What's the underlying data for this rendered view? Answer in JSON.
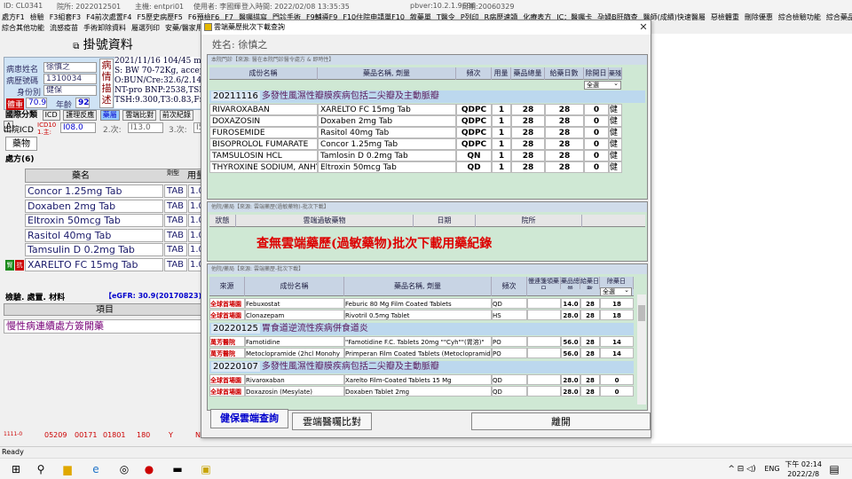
{
  "topbar": {
    "id": "ID: CL0341",
    "clinic": "院所: 2022012501",
    "host": "主機: entpri01",
    "user": "使用者: 李國輝",
    "login": "登入時間: 2022/02/08 13:35:35",
    "pbver": "pbver:10.2.1.9696",
    "date_ver": "日期:20060329"
  },
  "menu1": [
    "處方F1",
    "檢驗",
    "F3組套F3",
    "F4前次處置F4",
    "F5歷史病歷F5",
    "F6預檢F6",
    "F7",
    "醫囑描寫",
    "門診手術",
    "F9輔導F9",
    "F10住院申請單F10",
    "敘藥單",
    "T醫令",
    "P列印",
    "R病歷速讀",
    "化療表方",
    "IC：醫囑卡",
    "孕婦B肝篩查",
    "醫師(成績)快速醫屬",
    "惡檢體重",
    "刪除優惠",
    "綜合檢驗功能",
    "綜合藥品功能"
  ],
  "menu2": [
    "綜合其他功能",
    "流感疫苗",
    "手術卸除資料",
    "屬選列印",
    "安藥/醫家用藥單"
  ],
  "main": {
    "title": "掛號資料",
    "patient": {
      "name_label": "病患姓名",
      "name": "徐慎之",
      "id_label": "病歷號碼",
      "id": "1310034",
      "status_label": "身份別",
      "status": "健保",
      "weight_label": "體重",
      "weight": "70.9",
      "age_label": "年齡",
      "age": "92"
    },
    "disease_tag": "病情描述",
    "notes": [
      "2021/11/16 104/45 mmH",
      "S: BW 70-72Kg, accepta",
      "O:BUN/Cre:32.6/2.14,A",
      "NT-pro BNP:2538,TSH",
      "TSH:9.300,T3:0.83,Free"
    ],
    "tabs": [
      "國際分類",
      "ICD",
      "護理反應",
      "藥屬",
      "雲端比對",
      "前次紀錄",
      "A"
    ],
    "icd": {
      "label": "出院ICD",
      "code_label": "ICD10 1.主:",
      "code": "I08.0",
      "second_label": "2.次:",
      "second": "I13.0",
      "third_label": "3.次:",
      "third": "I5"
    },
    "meds_tab": "藥物",
    "rx_label": "處方(6)",
    "rx_headers": {
      "name": "藥名",
      "form": "劑型",
      "dose": "用量"
    },
    "rx": [
      {
        "name": "Concor 1.25mg Tab",
        "form": "TAB",
        "dose": "1.00"
      },
      {
        "name": "Doxaben 2mg Tab",
        "form": "TAB",
        "dose": "1.00"
      },
      {
        "name": "Eltroxin 50mcg Tab",
        "form": "TAB",
        "dose": "1.00"
      },
      {
        "name": "Rasitol 40mg Tab",
        "form": "TAB",
        "dose": "1.00"
      },
      {
        "name": "Tamsulin D 0.2mg Tab",
        "form": "TAB",
        "dose": "1.00"
      },
      {
        "name": "XARELTO FC 15mg Tab",
        "form": "TAB",
        "dose": "1.00"
      }
    ],
    "rx_flags": [
      "腎",
      "抗"
    ],
    "exam_label": "檢驗. 處置. 材料",
    "egfr": "【eGFR: 30.9(20170823)】",
    "items_head": "項目",
    "chronic": "慢性病連續處方簽開藥",
    "bottom_codes": [
      "1111-0",
      "05209",
      "00171",
      "01801",
      "180",
      "Y",
      "N"
    ]
  },
  "status": "Ready",
  "dialog": {
    "title": "雲端藥歷批次下載查詢",
    "patient_name": "姓名: 徐慎之",
    "panel1": {
      "caption": "本院門診【來源: 醫在本院門診醫令處方 & 即時性】",
      "headers": [
        "成份名稱",
        "藥品名稱, 劑量",
        "頻次",
        "用量",
        "藥品總量",
        "給藥日數",
        "除開日",
        "藥殘"
      ],
      "filter": "全選",
      "group": {
        "date": "20211116",
        "title": "多發性風濕性瓣膜疾病包括二尖瓣及主動脈瓣"
      },
      "rows": [
        {
          "ing": "RIVAROXABAN",
          "drug": "XARELTO FC 15mg Tab",
          "freq": "QDPC",
          "dose": "1",
          "total": "28",
          "days": "28",
          "exc": "0",
          "chk": "健"
        },
        {
          "ing": "DOXAZOSIN",
          "drug": "Doxaben 2mg Tab",
          "freq": "QDPC",
          "dose": "1",
          "total": "28",
          "days": "28",
          "exc": "0",
          "chk": "健"
        },
        {
          "ing": "FUROSEMIDE",
          "drug": "Rasitol 40mg Tab",
          "freq": "QDPC",
          "dose": "1",
          "total": "28",
          "days": "28",
          "exc": "0",
          "chk": "健"
        },
        {
          "ing": "BISOPROLOL FUMARATE",
          "drug": "Concor 1.25mg Tab",
          "freq": "QDPC",
          "dose": "1",
          "total": "28",
          "days": "28",
          "exc": "0",
          "chk": "健"
        },
        {
          "ing": "TAMSULOSIN HCL",
          "drug": "Tamlosin D 0.2mg Tab",
          "freq": "QN",
          "dose": "1",
          "total": "28",
          "days": "28",
          "exc": "0",
          "chk": "健"
        },
        {
          "ing": "THYROXINE SODIUM, ANHY",
          "drug": "Eltroxin 50mcg Tab",
          "freq": "QD",
          "dose": "1",
          "total": "28",
          "days": "28",
          "exc": "0",
          "chk": "健"
        }
      ]
    },
    "panel2": {
      "caption": "他院/藥局【來源: 雲端藥歷(過敏藥物)-批次下載】",
      "headers": [
        "狀態",
        "雲端過敏藥物",
        "日期",
        "院所"
      ],
      "message": "查無雲端藥歷(過敏藥物)批次下載用藥紀錄"
    },
    "panel3": {
      "caption": "他院/藥局【來源: 雲端藥歷-批次下載】",
      "headers": [
        "來源",
        "成份名稱",
        "藥品名稱, 劑量",
        "頻次",
        "慢連箋領藥日",
        "藥品總量",
        "給藥日數",
        "除藥日"
      ],
      "filter": "全選",
      "groups": [
        {
          "date": "",
          "title": "",
          "rows": [
            {
              "src": "全球首場園",
              "ing": "Febuxostat",
              "drug": "Feburic 80 Mg Film Coated Tablets",
              "freq": "QD",
              "total": "14.0",
              "days": "28",
              "exc": "18"
            },
            {
              "src": "全球首場園",
              "ing": "Clonazepam",
              "drug": "Rivotril 0.5mg Tablet",
              "freq": "HS",
              "total": "28.0",
              "days": "28",
              "exc": "18"
            }
          ]
        },
        {
          "date": "20220125",
          "title": "胃食道逆流性疾病併食道炎",
          "rows": [
            {
              "src": "萬芳醫院",
              "ing": "Famotidine",
              "drug": "\"Famotidine F.C. Tablets 20mg \"\"Cyh\"\"(胃溶)\"",
              "freq": "PO",
              "total": "56.0",
              "days": "28",
              "exc": "14"
            },
            {
              "src": "萬芳醫院",
              "ing": "Metoclopramide (2hcl Monohy",
              "drug": "Primperan Film Coated Tablets (Metoclopramide)",
              "freq": "PO",
              "total": "56.0",
              "days": "28",
              "exc": "14"
            }
          ]
        },
        {
          "date": "20220107",
          "title": "多發性風濕性瓣膜疾病包括二尖瓣及主動脈瓣",
          "rows": [
            {
              "src": "全球首場園",
              "ing": "Rivaroxaban",
              "drug": "Xarelto Film-Coated Tablets 15 Mg",
              "freq": "QD",
              "total": "28.0",
              "days": "28",
              "exc": "0"
            },
            {
              "src": "全球首場園",
              "ing": "Doxazosin (Mesylate)",
              "drug": "Doxaben Tablet 2mg",
              "freq": "QD",
              "total": "28.0",
              "days": "28",
              "exc": "0"
            }
          ]
        }
      ]
    },
    "buttons": {
      "cloud_query": "健保雲端查詢",
      "compare": "雲端醫囑比對",
      "leave": "離開"
    }
  },
  "taskbar": {
    "lang": "ENG",
    "time": "下午 02:14",
    "date": "2022/2/8"
  },
  "colors": {
    "group_bg": "#bcd8ee",
    "panel_bg": "#cfe8d4",
    "alert": "#d00000"
  }
}
